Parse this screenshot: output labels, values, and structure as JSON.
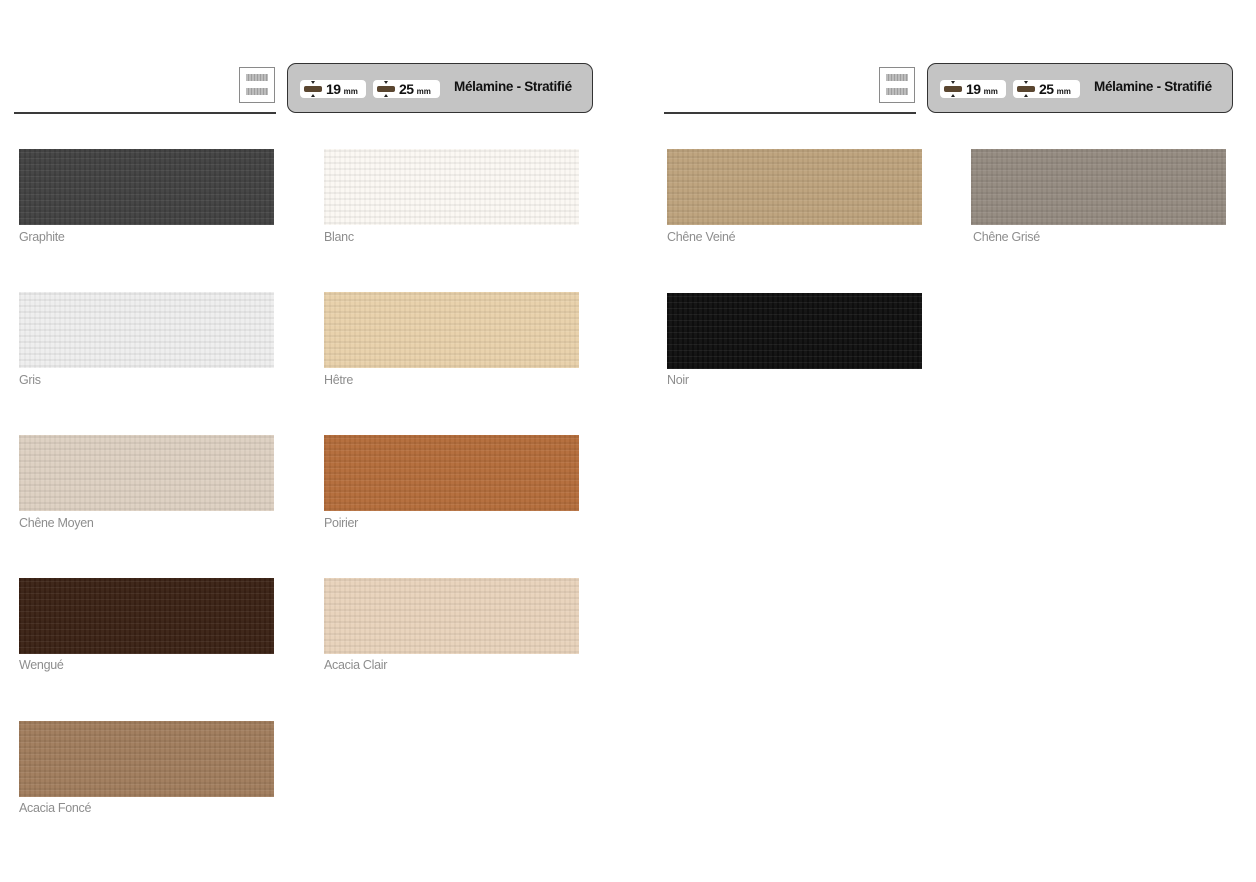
{
  "headers": [
    {
      "t19": "19",
      "t25": "25",
      "unit": "mm",
      "label": "Mélamine - Stratifié"
    },
    {
      "t19": "19",
      "t25": "25",
      "unit": "mm",
      "label": "Mélamine - Stratifié"
    }
  ],
  "swatches": [
    {
      "name": "Graphite",
      "color": "#414141"
    },
    {
      "name": "Blanc",
      "color": "#fbf8f3"
    },
    {
      "name": "Gris",
      "color": "#eeeeee"
    },
    {
      "name": "Hêtre",
      "color": "#e8d1aa"
    },
    {
      "name": "Chêne Moyen",
      "color": "#ddd0c1"
    },
    {
      "name": "Poirier",
      "color": "#b46c3a"
    },
    {
      "name": "Wengué",
      "color": "#3a2114"
    },
    {
      "name": "Acacia Clair",
      "color": "#e8d3bb"
    },
    {
      "name": "Acacia Foncé",
      "color": "#a07c5c"
    },
    {
      "name": "Chêne Veiné",
      "color": "#bda27c"
    },
    {
      "name": "Chêne Grisé",
      "color": "#948a80"
    },
    {
      "name": "Noir",
      "color": "#0e0e0e"
    }
  ]
}
